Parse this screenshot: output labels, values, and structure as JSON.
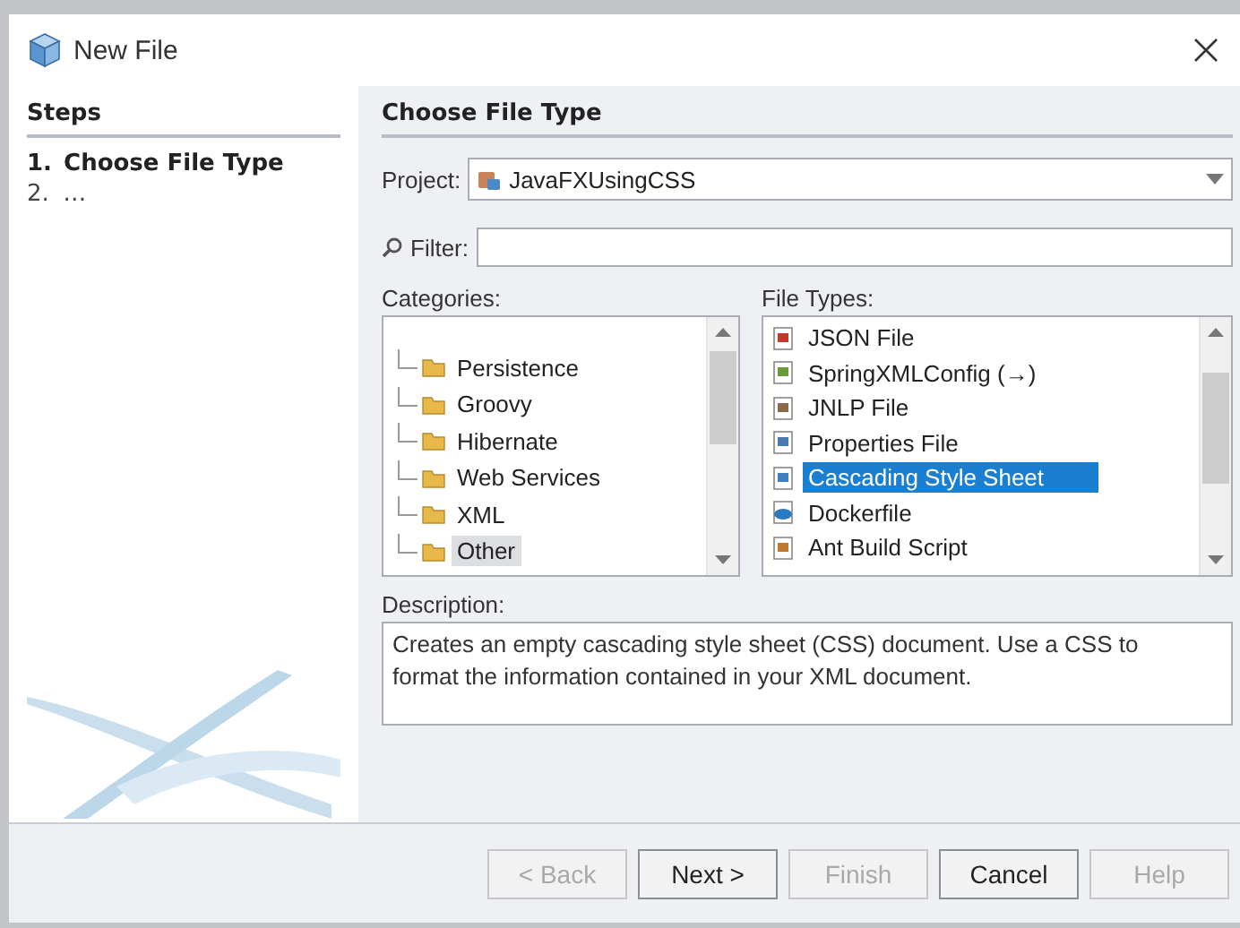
{
  "window": {
    "title": "New File"
  },
  "steps": {
    "heading": "Steps",
    "items": [
      {
        "number": "1.",
        "label": "Choose File Type",
        "selected": true
      },
      {
        "number": "2.",
        "label": "…",
        "selected": false
      }
    ]
  },
  "panel": {
    "title": "Choose File Type",
    "project": {
      "label": "Project:",
      "value": "JavaFXUsingCSS"
    },
    "filter": {
      "label": "Filter:"
    },
    "categories": {
      "label": "Categories:",
      "items": [
        {
          "label": "Persistence",
          "selected": false
        },
        {
          "label": "Groovy",
          "selected": false
        },
        {
          "label": "Hibernate",
          "selected": false
        },
        {
          "label": "Web Services",
          "selected": false
        },
        {
          "label": "XML",
          "selected": false
        },
        {
          "label": "Other",
          "selected": true
        }
      ]
    },
    "file_types": {
      "label": "File Types:",
      "items": [
        {
          "label": "JSON File",
          "kind": "json",
          "selected": false
        },
        {
          "label": "SpringXMLConfig (→)",
          "kind": "spring",
          "selected": false
        },
        {
          "label": "JNLP File",
          "kind": "jnlp",
          "selected": false
        },
        {
          "label": "Properties File",
          "kind": "properties",
          "selected": false
        },
        {
          "label": "Cascading Style Sheet",
          "kind": "css",
          "selected": true
        },
        {
          "label": "Dockerfile",
          "kind": "docker",
          "selected": false
        },
        {
          "label": "Ant Build Script",
          "kind": "ant",
          "selected": false
        }
      ]
    },
    "description": {
      "label": "Description:",
      "text": "Creates an empty cascading style sheet (CSS) document. Use a CSS to format the information contained in your XML document."
    }
  },
  "buttons": [
    {
      "label": "< Back",
      "disabled": true
    },
    {
      "label": "Next >",
      "disabled": false
    },
    {
      "label": "Finish",
      "disabled": true
    },
    {
      "label": "Cancel",
      "disabled": false
    },
    {
      "label": "Help",
      "disabled": true
    }
  ]
}
